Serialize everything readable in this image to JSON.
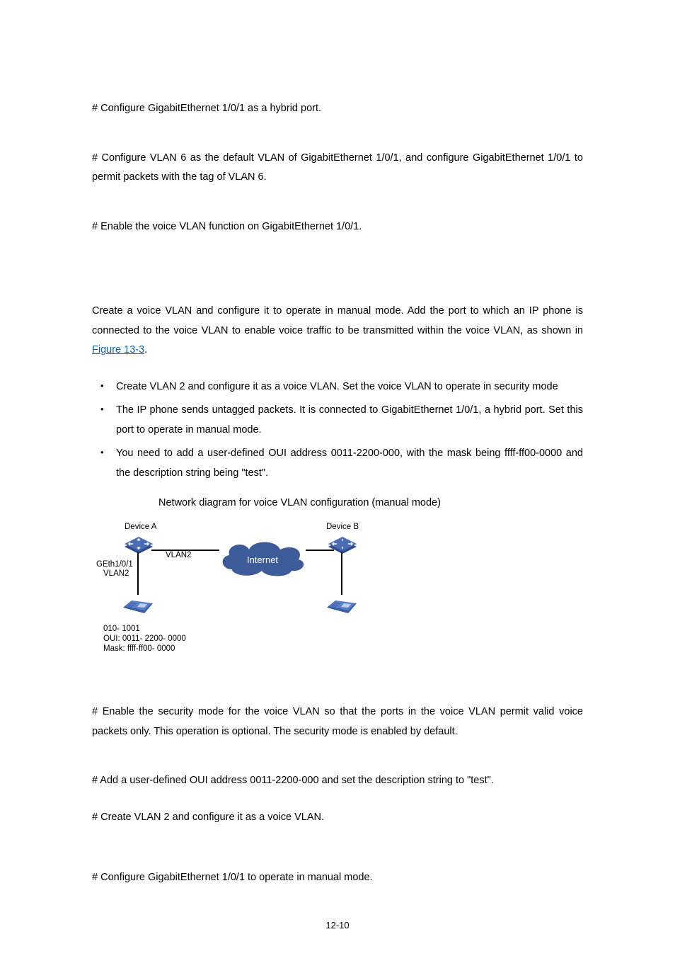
{
  "p1": "# Configure GigabitEthernet 1/0/1 as a hybrid port.",
  "p2": "# Configure VLAN 6 as the default VLAN of GigabitEthernet 1/0/1, and configure GigabitEthernet 1/0/1 to permit packets with the tag of VLAN 6.",
  "p3": "# Enable the voice VLAN function on GigabitEthernet 1/0/1.",
  "intro_a": "Create a voice VLAN and configure it to operate in manual mode. Add the port to which an IP phone is connected to the voice VLAN to enable voice traffic to be transmitted within the voice VLAN, as shown in ",
  "intro_link": "Figure 13-3",
  "intro_b": ".",
  "bullets": [
    "Create VLAN 2 and configure it as a voice VLAN. Set the voice VLAN to operate in security mode",
    "The IP phone sends untagged packets. It is connected to GigabitEthernet 1/0/1, a hybrid port. Set this port to operate in manual mode.",
    "You need to add a user-defined OUI address 0011-2200-000, with the mask being ffff-ff00-0000 and the description string being \"test\"."
  ],
  "fig_caption": "Network diagram for voice VLAN configuration (manual mode)",
  "diagram": {
    "device_a": "Device A",
    "device_b": "Device B",
    "internet": "Internet",
    "vlan2_a": "VLAN2",
    "geth": "GEth1/0/1",
    "vlan2_b": "VLAN2",
    "phone_num": "010- 1001",
    "oui": "OUI: 0011- 2200- 0000",
    "mask": "Mask: ffff-ff00- 0000"
  },
  "p5": "# Enable the security mode for the voice VLAN so that the ports in the voice VLAN permit valid voice packets only. This operation is optional. The security mode is enabled by default.",
  "p6": "# Add a user-defined OUI address 0011-2200-000 and set the description string to \"test\".",
  "p7": "# Create VLAN 2 and configure it as a voice VLAN.",
  "p8": "# Configure GigabitEthernet 1/0/1 to operate in manual mode.",
  "page_number": "12-10"
}
